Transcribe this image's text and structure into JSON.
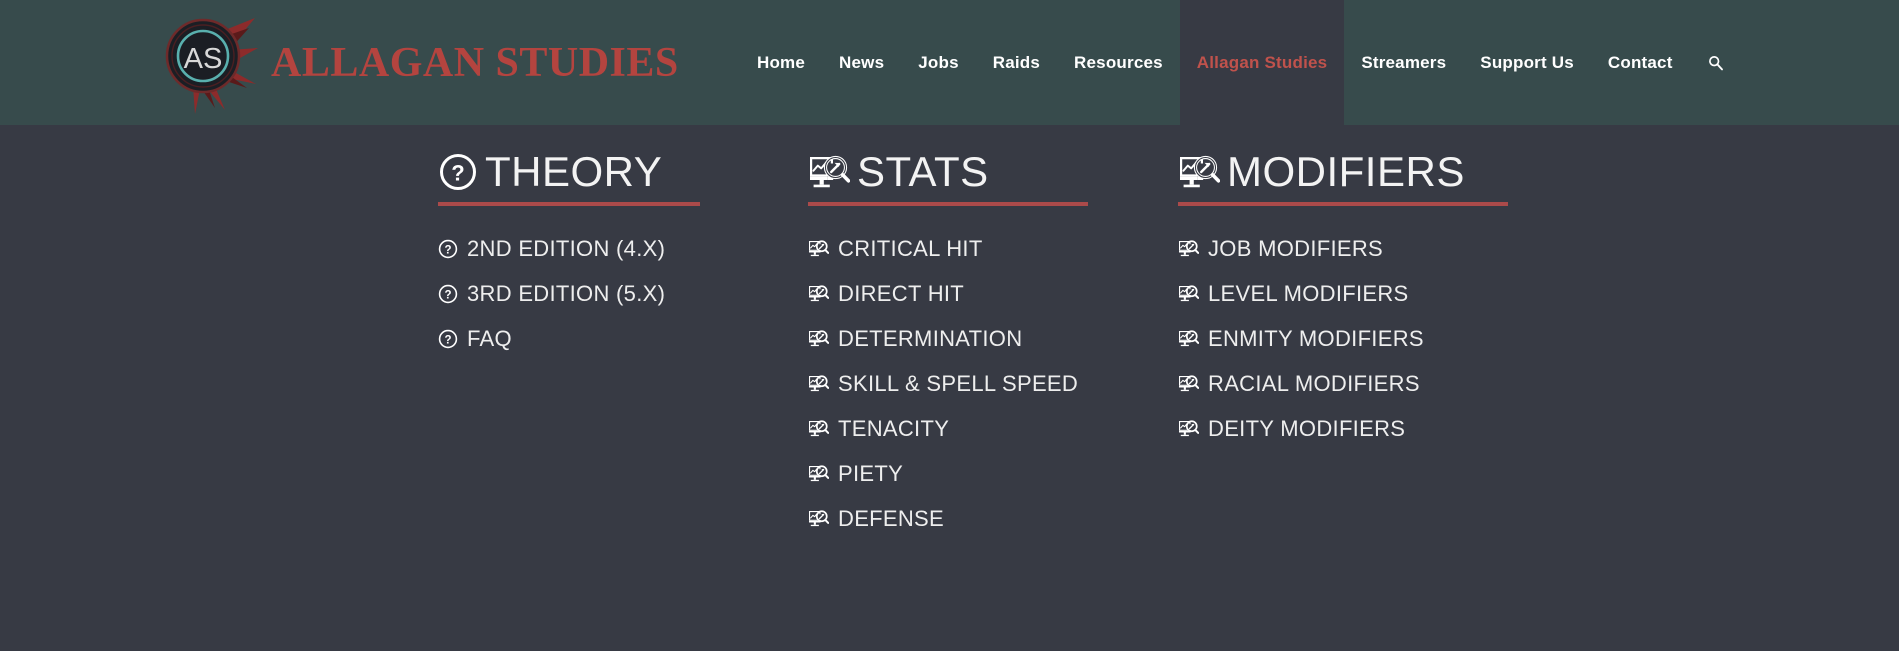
{
  "brand": {
    "logo_icon": "allagan-studies-emblem",
    "logo_initials": "AS",
    "title": "ALLAGAN STUDIES",
    "brand_color": "#b4443f"
  },
  "nav": {
    "items": [
      {
        "label": "Home",
        "active": false
      },
      {
        "label": "News",
        "active": false
      },
      {
        "label": "Jobs",
        "active": false
      },
      {
        "label": "Raids",
        "active": false
      },
      {
        "label": "Resources",
        "active": false
      },
      {
        "label": "Allagan Studies",
        "active": true
      },
      {
        "label": "Streamers",
        "active": false
      },
      {
        "label": "Support Us",
        "active": false
      },
      {
        "label": "Contact",
        "active": false
      }
    ],
    "search_icon": "search-icon",
    "active_color": "#c0524c",
    "header_bg": "#374b4c"
  },
  "mega_menu": {
    "accent_color": "#ab4a4a",
    "panel_bg": "#373a44",
    "columns": [
      {
        "key": "theory",
        "heading": "THEORY",
        "heading_icon": "question-circle-icon",
        "items": [
          {
            "label": "2ND EDITION (4.X)",
            "icon": "question-circle-icon"
          },
          {
            "label": "3RD EDITION (5.X)",
            "icon": "question-circle-icon"
          },
          {
            "label": "FAQ",
            "icon": "question-circle-icon"
          }
        ]
      },
      {
        "key": "stats",
        "heading": "STATS",
        "heading_icon": "monitor-chart-search-icon",
        "items": [
          {
            "label": "CRITICAL HIT",
            "icon": "monitor-chart-search-icon"
          },
          {
            "label": "DIRECT HIT",
            "icon": "monitor-chart-search-icon"
          },
          {
            "label": "DETERMINATION",
            "icon": "monitor-chart-search-icon"
          },
          {
            "label": "SKILL & SPELL SPEED",
            "icon": "monitor-chart-search-icon"
          },
          {
            "label": "TENACITY",
            "icon": "monitor-chart-search-icon"
          },
          {
            "label": "PIETY",
            "icon": "monitor-chart-search-icon"
          },
          {
            "label": "DEFENSE",
            "icon": "monitor-chart-search-icon"
          }
        ]
      },
      {
        "key": "modifiers",
        "heading": "MODIFIERS",
        "heading_icon": "monitor-chart-search-icon",
        "items": [
          {
            "label": "JOB MODIFIERS",
            "icon": "monitor-chart-search-icon"
          },
          {
            "label": "LEVEL MODIFIERS",
            "icon": "monitor-chart-search-icon"
          },
          {
            "label": "ENMITY MODIFIERS",
            "icon": "monitor-chart-search-icon"
          },
          {
            "label": "RACIAL MODIFIERS",
            "icon": "monitor-chart-search-icon"
          },
          {
            "label": "DEITY MODIFIERS",
            "icon": "monitor-chart-search-icon"
          }
        ]
      }
    ]
  }
}
